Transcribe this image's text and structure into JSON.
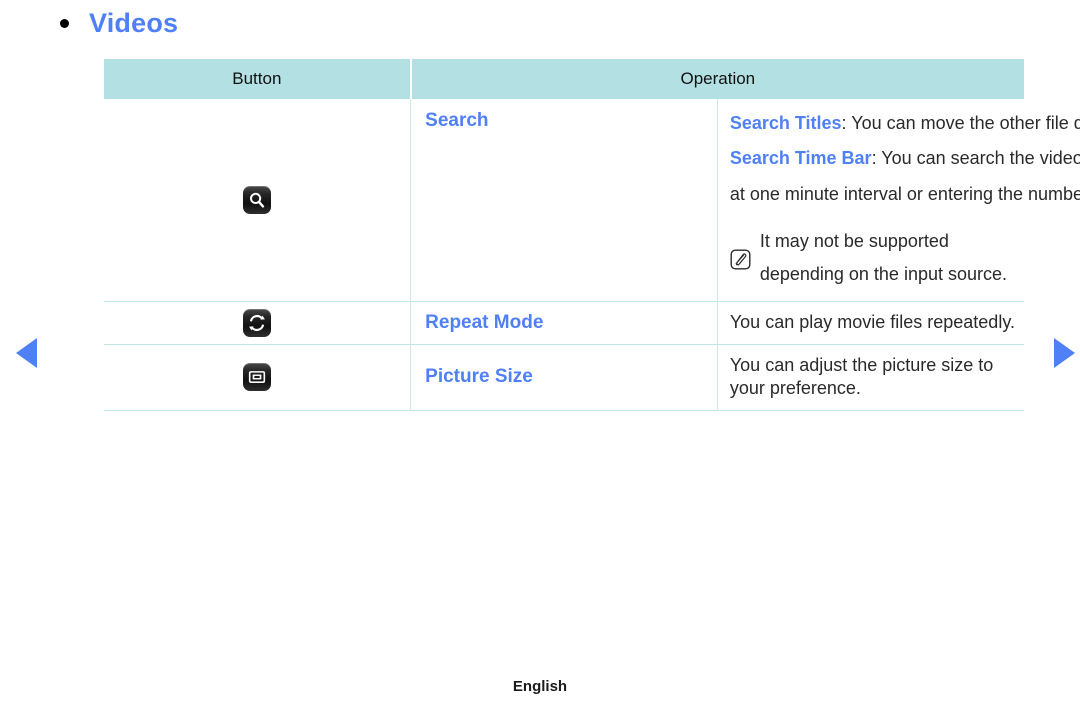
{
  "heading": {
    "bullet_icon": "bullet-dot-icon",
    "title": "Videos",
    "title_color": "#4f80f7"
  },
  "table": {
    "header": {
      "button_label": "Button",
      "operation_label": "Operation",
      "background_color": "#b2e0e3"
    },
    "rows": [
      {
        "icon": "search-icon",
        "label": "Search",
        "lines": [
          {
            "term": "Search Titles",
            "text": ": You can move the other file directly."
          },
          {
            "term": "Search Time Bar",
            "text": ": You can search the video using ◀ and ▶ button"
          },
          {
            "term": "",
            "text": "at one minute interval or entering the number directly."
          }
        ],
        "note": {
          "icon": "note-icon",
          "text": "It may not be supported depending on the input source."
        }
      },
      {
        "icon": "repeat-icon",
        "label": "Repeat Mode",
        "description": "You can play movie files repeatedly."
      },
      {
        "icon": "picture-size-icon",
        "label": "Picture Size",
        "description": "You can adjust the picture size to your preference."
      }
    ]
  },
  "navigation": {
    "prev_icon": "arrow-left-icon",
    "next_icon": "arrow-right-icon",
    "arrow_color": "#4f80f7"
  },
  "footer": {
    "language": "English"
  }
}
